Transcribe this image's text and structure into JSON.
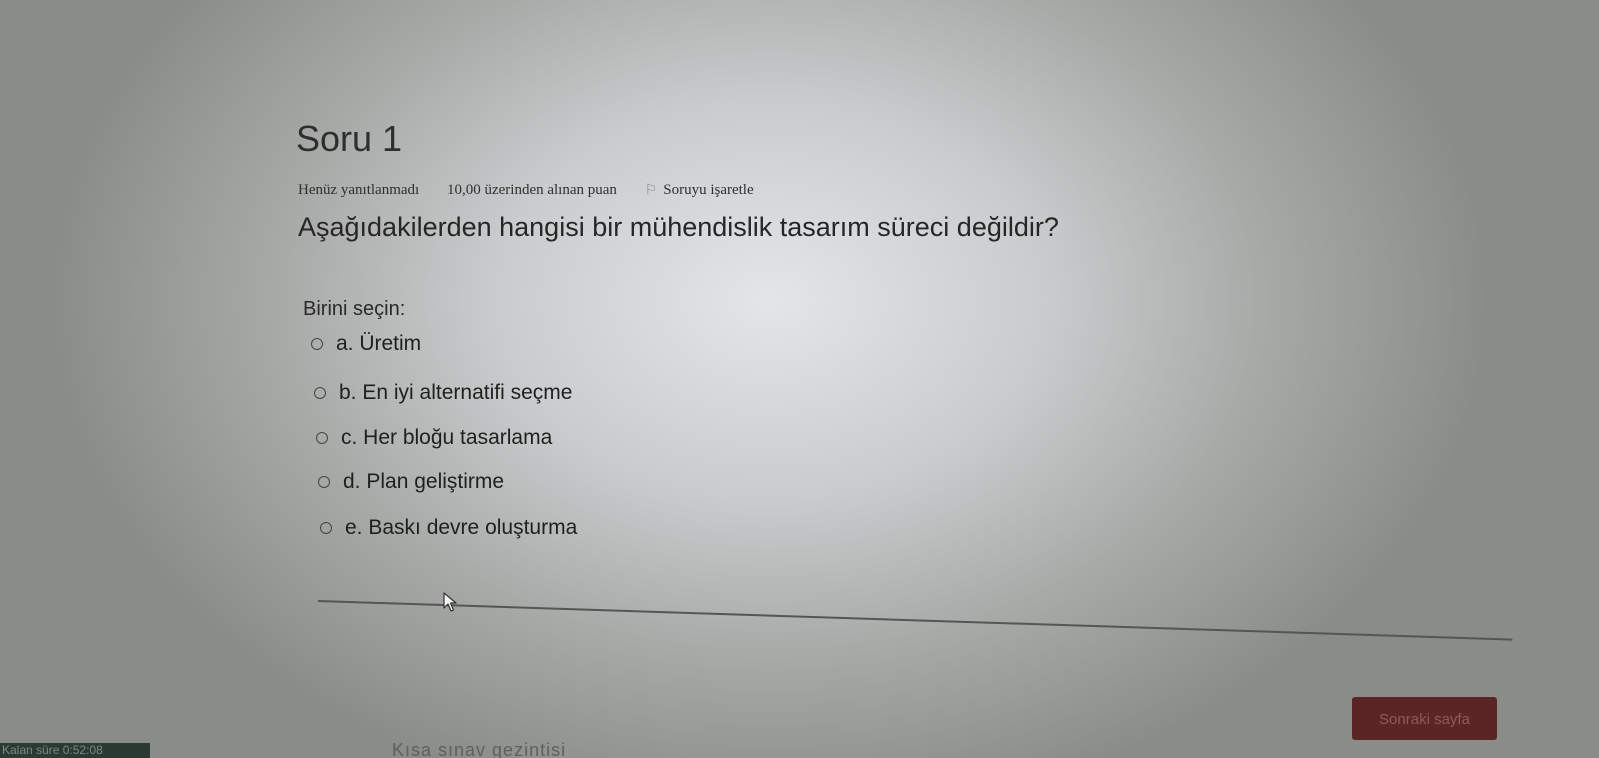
{
  "question": {
    "title": "Soru 1",
    "state": "Henüz yanıtlanmadı",
    "grade_text": "10,00 üzerinden alınan puan",
    "flag_label": "Soruyu işaretle",
    "text": "Aşağıdakilerden hangisi bir mühendislik tasarım süreci değildir?",
    "prompt": "Birini seçin:",
    "options": [
      {
        "label": "a. Üretim",
        "selected": false
      },
      {
        "label": "b. En iyi alternatifi seçme",
        "selected": false
      },
      {
        "label": "c. Her bloğu tasarlama",
        "selected": false
      },
      {
        "label": "d. Plan geliştirme",
        "selected": false
      },
      {
        "label": "e. Baskı devre oluşturma",
        "selected": false
      }
    ]
  },
  "navigation": {
    "next_page_label": "Sonraki sayfa"
  },
  "footer": {
    "partial_text": "Kısa sınav gezintisi"
  },
  "taskbar": {
    "partial_text": "Kalan süre 0:52:08"
  },
  "colors": {
    "button_bg": "#5a2524",
    "text": "#2d2d2d"
  },
  "icons": {
    "flag": "flag-icon",
    "radio": "radio-unchecked-icon",
    "cursor": "mouse-cursor-icon"
  }
}
